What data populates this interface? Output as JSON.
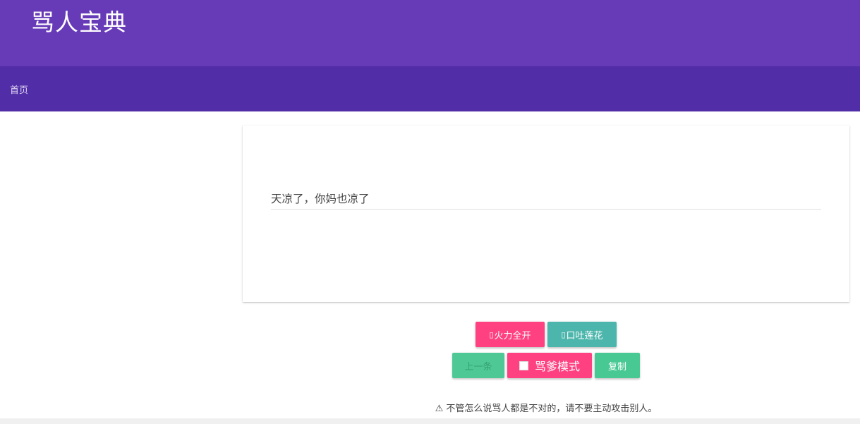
{
  "app": {
    "title": "骂人宝典"
  },
  "nav": {
    "home": "首页"
  },
  "content": {
    "text": "天凉了，你妈也凉了"
  },
  "buttons": {
    "fire_full": "火力全开",
    "lotus_spit": "口吐莲花",
    "prev": "上一条",
    "mode": "骂爹模式",
    "copy": "复制"
  },
  "mode_checked": false,
  "warning": {
    "icon": "warning-icon",
    "text": "⚠ 不管怎么说骂人都是不对的，请不要主动攻击别人。"
  },
  "colors": {
    "header": "#673ab7",
    "nav": "#512da8",
    "pink": "#ff4081",
    "teal": "#4db6ac",
    "green": "#48c993"
  }
}
